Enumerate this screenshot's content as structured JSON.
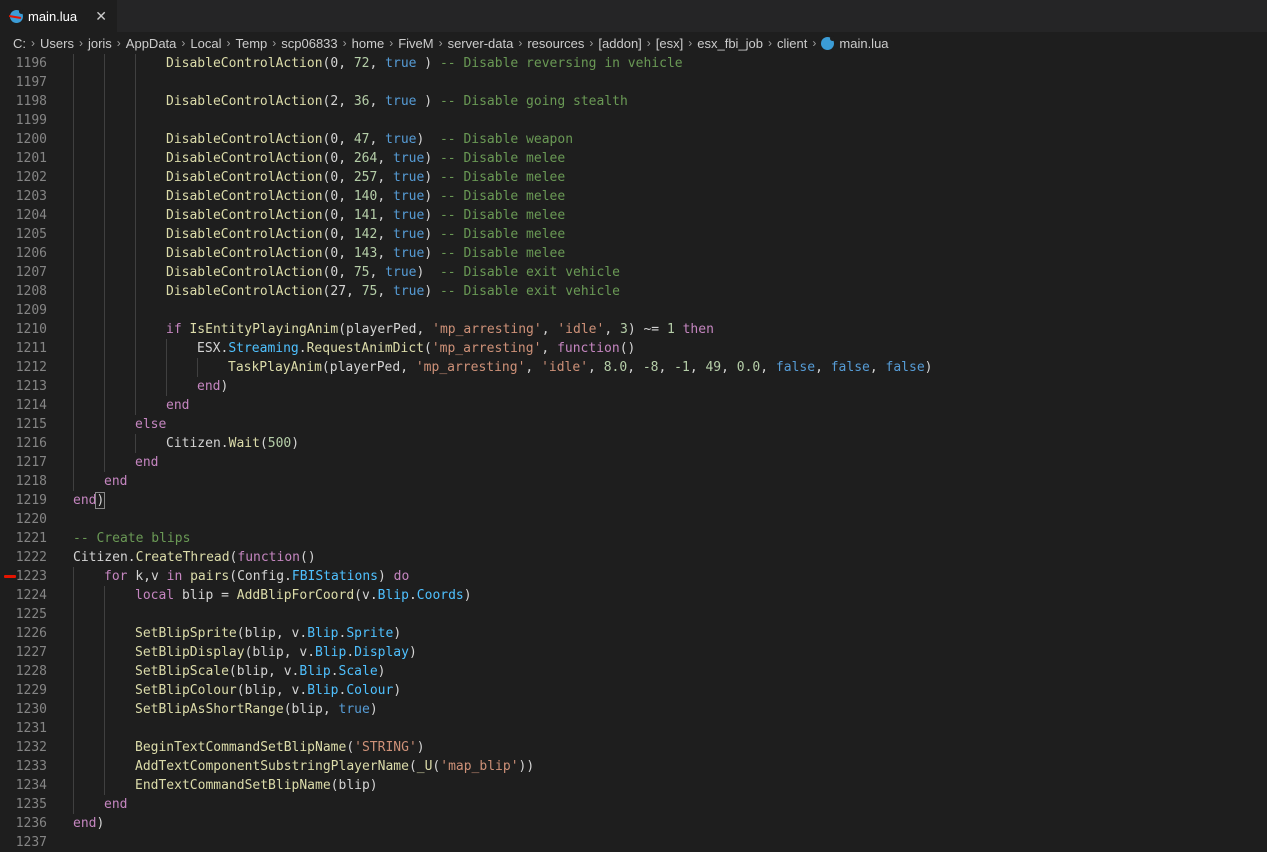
{
  "tab": {
    "label": "main.lua",
    "close_label": "✕"
  },
  "breadcrumb": {
    "parts": [
      "C:",
      "Users",
      "joris",
      "AppData",
      "Local",
      "Temp",
      "scp06833",
      "home",
      "FiveM",
      "server-data",
      "resources",
      "[addon]",
      "[esx]",
      "esx_fbi_job",
      "client"
    ],
    "file": "main.lua",
    "separator": "›"
  },
  "colors": {
    "keyword": "#c586c0",
    "function": "#dcdcaa",
    "number": "#b5cea8",
    "boolean": "#569cd6",
    "string": "#ce9178",
    "comment": "#6a9955",
    "property": "#4fc1ff",
    "breakpoint": "#e51400"
  },
  "breakpoint_line": "1223",
  "lines": [
    {
      "n": "1196",
      "i": 3,
      "t": [
        [
          "fn",
          "DisableControlAction"
        ],
        [
          "",
          "(0, "
        ],
        [
          "num",
          "72"
        ],
        [
          "",
          ", "
        ],
        [
          "bool",
          "true"
        ],
        [
          "",
          " ) "
        ],
        [
          "cmt",
          "-- Disable reversing in vehicle"
        ]
      ]
    },
    {
      "n": "1197",
      "i": 3,
      "t": []
    },
    {
      "n": "1198",
      "i": 3,
      "t": [
        [
          "fn",
          "DisableControlAction"
        ],
        [
          "",
          "(2, "
        ],
        [
          "num",
          "36"
        ],
        [
          "",
          ", "
        ],
        [
          "bool",
          "true"
        ],
        [
          "",
          " ) "
        ],
        [
          "cmt",
          "-- Disable going stealth"
        ]
      ]
    },
    {
      "n": "1199",
      "i": 3,
      "t": []
    },
    {
      "n": "1200",
      "i": 3,
      "t": [
        [
          "fn",
          "DisableControlAction"
        ],
        [
          "",
          "(0, "
        ],
        [
          "num",
          "47"
        ],
        [
          "",
          ", "
        ],
        [
          "bool",
          "true"
        ],
        [
          "",
          ")  "
        ],
        [
          "cmt",
          "-- Disable weapon"
        ]
      ]
    },
    {
      "n": "1201",
      "i": 3,
      "t": [
        [
          "fn",
          "DisableControlAction"
        ],
        [
          "",
          "(0, "
        ],
        [
          "num",
          "264"
        ],
        [
          "",
          ", "
        ],
        [
          "bool",
          "true"
        ],
        [
          "",
          ") "
        ],
        [
          "cmt",
          "-- Disable melee"
        ]
      ]
    },
    {
      "n": "1202",
      "i": 3,
      "t": [
        [
          "fn",
          "DisableControlAction"
        ],
        [
          "",
          "(0, "
        ],
        [
          "num",
          "257"
        ],
        [
          "",
          ", "
        ],
        [
          "bool",
          "true"
        ],
        [
          "",
          ") "
        ],
        [
          "cmt",
          "-- Disable melee"
        ]
      ]
    },
    {
      "n": "1203",
      "i": 3,
      "t": [
        [
          "fn",
          "DisableControlAction"
        ],
        [
          "",
          "(0, "
        ],
        [
          "num",
          "140"
        ],
        [
          "",
          ", "
        ],
        [
          "bool",
          "true"
        ],
        [
          "",
          ") "
        ],
        [
          "cmt",
          "-- Disable melee"
        ]
      ]
    },
    {
      "n": "1204",
      "i": 3,
      "t": [
        [
          "fn",
          "DisableControlAction"
        ],
        [
          "",
          "(0, "
        ],
        [
          "num",
          "141"
        ],
        [
          "",
          ", "
        ],
        [
          "bool",
          "true"
        ],
        [
          "",
          ") "
        ],
        [
          "cmt",
          "-- Disable melee"
        ]
      ]
    },
    {
      "n": "1205",
      "i": 3,
      "t": [
        [
          "fn",
          "DisableControlAction"
        ],
        [
          "",
          "(0, "
        ],
        [
          "num",
          "142"
        ],
        [
          "",
          ", "
        ],
        [
          "bool",
          "true"
        ],
        [
          "",
          ") "
        ],
        [
          "cmt",
          "-- Disable melee"
        ]
      ]
    },
    {
      "n": "1206",
      "i": 3,
      "t": [
        [
          "fn",
          "DisableControlAction"
        ],
        [
          "",
          "(0, "
        ],
        [
          "num",
          "143"
        ],
        [
          "",
          ", "
        ],
        [
          "bool",
          "true"
        ],
        [
          "",
          ") "
        ],
        [
          "cmt",
          "-- Disable melee"
        ]
      ]
    },
    {
      "n": "1207",
      "i": 3,
      "t": [
        [
          "fn",
          "DisableControlAction"
        ],
        [
          "",
          "(0, "
        ],
        [
          "num",
          "75"
        ],
        [
          "",
          ", "
        ],
        [
          "bool",
          "true"
        ],
        [
          "",
          ")  "
        ],
        [
          "cmt",
          "-- Disable exit vehicle"
        ]
      ]
    },
    {
      "n": "1208",
      "i": 3,
      "t": [
        [
          "fn",
          "DisableControlAction"
        ],
        [
          "",
          "(27, "
        ],
        [
          "num",
          "75"
        ],
        [
          "",
          ", "
        ],
        [
          "bool",
          "true"
        ],
        [
          "",
          ") "
        ],
        [
          "cmt",
          "-- Disable exit vehicle"
        ]
      ]
    },
    {
      "n": "1209",
      "i": 3,
      "t": []
    },
    {
      "n": "1210",
      "i": 3,
      "t": [
        [
          "kw",
          "if "
        ],
        [
          "fn",
          "IsEntityPlayingAnim"
        ],
        [
          "",
          "(playerPed, "
        ],
        [
          "str",
          "'mp_arresting'"
        ],
        [
          "",
          ", "
        ],
        [
          "str",
          "'idle'"
        ],
        [
          "",
          ", "
        ],
        [
          "num",
          "3"
        ],
        [
          "",
          ") ~= "
        ],
        [
          "num",
          "1"
        ],
        [
          "kw",
          " then"
        ]
      ]
    },
    {
      "n": "1211",
      "i": 4,
      "t": [
        [
          "",
          "ESX."
        ],
        [
          "prop",
          "Streaming"
        ],
        [
          "",
          "."
        ],
        [
          "fn",
          "RequestAnimDict"
        ],
        [
          "",
          "("
        ],
        [
          "str",
          "'mp_arresting'"
        ],
        [
          "",
          ", "
        ],
        [
          "kw",
          "function"
        ],
        [
          "",
          "()"
        ]
      ]
    },
    {
      "n": "1212",
      "i": 5,
      "t": [
        [
          "fn",
          "TaskPlayAnim"
        ],
        [
          "",
          "(playerPed, "
        ],
        [
          "str",
          "'mp_arresting'"
        ],
        [
          "",
          ", "
        ],
        [
          "str",
          "'idle'"
        ],
        [
          "",
          ", "
        ],
        [
          "num",
          "8.0"
        ],
        [
          "",
          ", "
        ],
        [
          "num",
          "-8"
        ],
        [
          "",
          ", "
        ],
        [
          "num",
          "-1"
        ],
        [
          "",
          ", "
        ],
        [
          "num",
          "49"
        ],
        [
          "",
          ", "
        ],
        [
          "num",
          "0.0"
        ],
        [
          "",
          ", "
        ],
        [
          "bool",
          "false"
        ],
        [
          "",
          ", "
        ],
        [
          "bool",
          "false"
        ],
        [
          "",
          ", "
        ],
        [
          "bool",
          "false"
        ],
        [
          "",
          ")"
        ]
      ]
    },
    {
      "n": "1213",
      "i": 4,
      "t": [
        [
          "kw",
          "end"
        ],
        [
          "",
          ")"
        ]
      ]
    },
    {
      "n": "1214",
      "i": 3,
      "t": [
        [
          "kw",
          "end"
        ]
      ]
    },
    {
      "n": "1215",
      "i": 2,
      "t": [
        [
          "kw",
          "else"
        ]
      ]
    },
    {
      "n": "1216",
      "i": 3,
      "t": [
        [
          "",
          "Citizen."
        ],
        [
          "fn",
          "Wait"
        ],
        [
          "",
          "("
        ],
        [
          "num",
          "500"
        ],
        [
          "",
          ")"
        ]
      ]
    },
    {
      "n": "1217",
      "i": 2,
      "t": [
        [
          "kw",
          "end"
        ]
      ]
    },
    {
      "n": "1218",
      "i": 1,
      "t": [
        [
          "kw",
          "end"
        ]
      ]
    },
    {
      "n": "1219",
      "i": 0,
      "t": [
        [
          "kw",
          "end"
        ],
        [
          "hl",
          ")"
        ]
      ]
    },
    {
      "n": "1220",
      "i": 0,
      "t": []
    },
    {
      "n": "1221",
      "i": 0,
      "t": [
        [
          "cmt",
          "-- Create blips"
        ]
      ]
    },
    {
      "n": "1222",
      "i": 0,
      "t": [
        [
          "",
          "Citizen."
        ],
        [
          "fn",
          "CreateThread"
        ],
        [
          "",
          "("
        ],
        [
          "kw",
          "function"
        ],
        [
          "",
          "()"
        ]
      ]
    },
    {
      "n": "1223",
      "i": 1,
      "t": [
        [
          "kw",
          "for "
        ],
        [
          "",
          "k,v "
        ],
        [
          "kw",
          "in "
        ],
        [
          "fn",
          "pairs"
        ],
        [
          "",
          "(Config."
        ],
        [
          "prop",
          "FBIStations"
        ],
        [
          "",
          ") "
        ],
        [
          "kw",
          "do"
        ]
      ]
    },
    {
      "n": "1224",
      "i": 2,
      "t": [
        [
          "kw",
          "local "
        ],
        [
          "",
          "blip = "
        ],
        [
          "fn",
          "AddBlipForCoord"
        ],
        [
          "",
          "(v."
        ],
        [
          "prop",
          "Blip"
        ],
        [
          "",
          "."
        ],
        [
          "prop",
          "Coords"
        ],
        [
          "",
          ")"
        ]
      ]
    },
    {
      "n": "1225",
      "i": 2,
      "t": []
    },
    {
      "n": "1226",
      "i": 2,
      "t": [
        [
          "fn",
          "SetBlipSprite"
        ],
        [
          "",
          "(blip, v."
        ],
        [
          "prop",
          "Blip"
        ],
        [
          "",
          "."
        ],
        [
          "prop",
          "Sprite"
        ],
        [
          "",
          ")"
        ]
      ]
    },
    {
      "n": "1227",
      "i": 2,
      "t": [
        [
          "fn",
          "SetBlipDisplay"
        ],
        [
          "",
          "(blip, v."
        ],
        [
          "prop",
          "Blip"
        ],
        [
          "",
          "."
        ],
        [
          "prop",
          "Display"
        ],
        [
          "",
          ")"
        ]
      ]
    },
    {
      "n": "1228",
      "i": 2,
      "t": [
        [
          "fn",
          "SetBlipScale"
        ],
        [
          "",
          "(blip, v."
        ],
        [
          "prop",
          "Blip"
        ],
        [
          "",
          "."
        ],
        [
          "prop",
          "Scale"
        ],
        [
          "",
          ")"
        ]
      ]
    },
    {
      "n": "1229",
      "i": 2,
      "t": [
        [
          "fn",
          "SetBlipColour"
        ],
        [
          "",
          "(blip, v."
        ],
        [
          "prop",
          "Blip"
        ],
        [
          "",
          "."
        ],
        [
          "prop",
          "Colour"
        ],
        [
          "",
          ")"
        ]
      ]
    },
    {
      "n": "1230",
      "i": 2,
      "t": [
        [
          "fn",
          "SetBlipAsShortRange"
        ],
        [
          "",
          "(blip, "
        ],
        [
          "bool",
          "true"
        ],
        [
          "",
          ")"
        ]
      ]
    },
    {
      "n": "1231",
      "i": 2,
      "t": []
    },
    {
      "n": "1232",
      "i": 2,
      "t": [
        [
          "fn",
          "BeginTextCommandSetBlipName"
        ],
        [
          "",
          "("
        ],
        [
          "str",
          "'STRING'"
        ],
        [
          "",
          ")"
        ]
      ]
    },
    {
      "n": "1233",
      "i": 2,
      "t": [
        [
          "fn",
          "AddTextComponentSubstringPlayerName"
        ],
        [
          "",
          "("
        ],
        [
          "fn",
          "_U"
        ],
        [
          "",
          "("
        ],
        [
          "str",
          "'map_blip'"
        ],
        [
          "",
          "))"
        ]
      ]
    },
    {
      "n": "1234",
      "i": 2,
      "t": [
        [
          "fn",
          "EndTextCommandSetBlipName"
        ],
        [
          "",
          "(blip)"
        ]
      ]
    },
    {
      "n": "1235",
      "i": 1,
      "t": [
        [
          "kw",
          "end"
        ]
      ]
    },
    {
      "n": "1236",
      "i": 0,
      "t": [
        [
          "kw",
          "end"
        ],
        [
          "",
          ")"
        ]
      ]
    },
    {
      "n": "1237",
      "i": 0,
      "t": []
    }
  ]
}
